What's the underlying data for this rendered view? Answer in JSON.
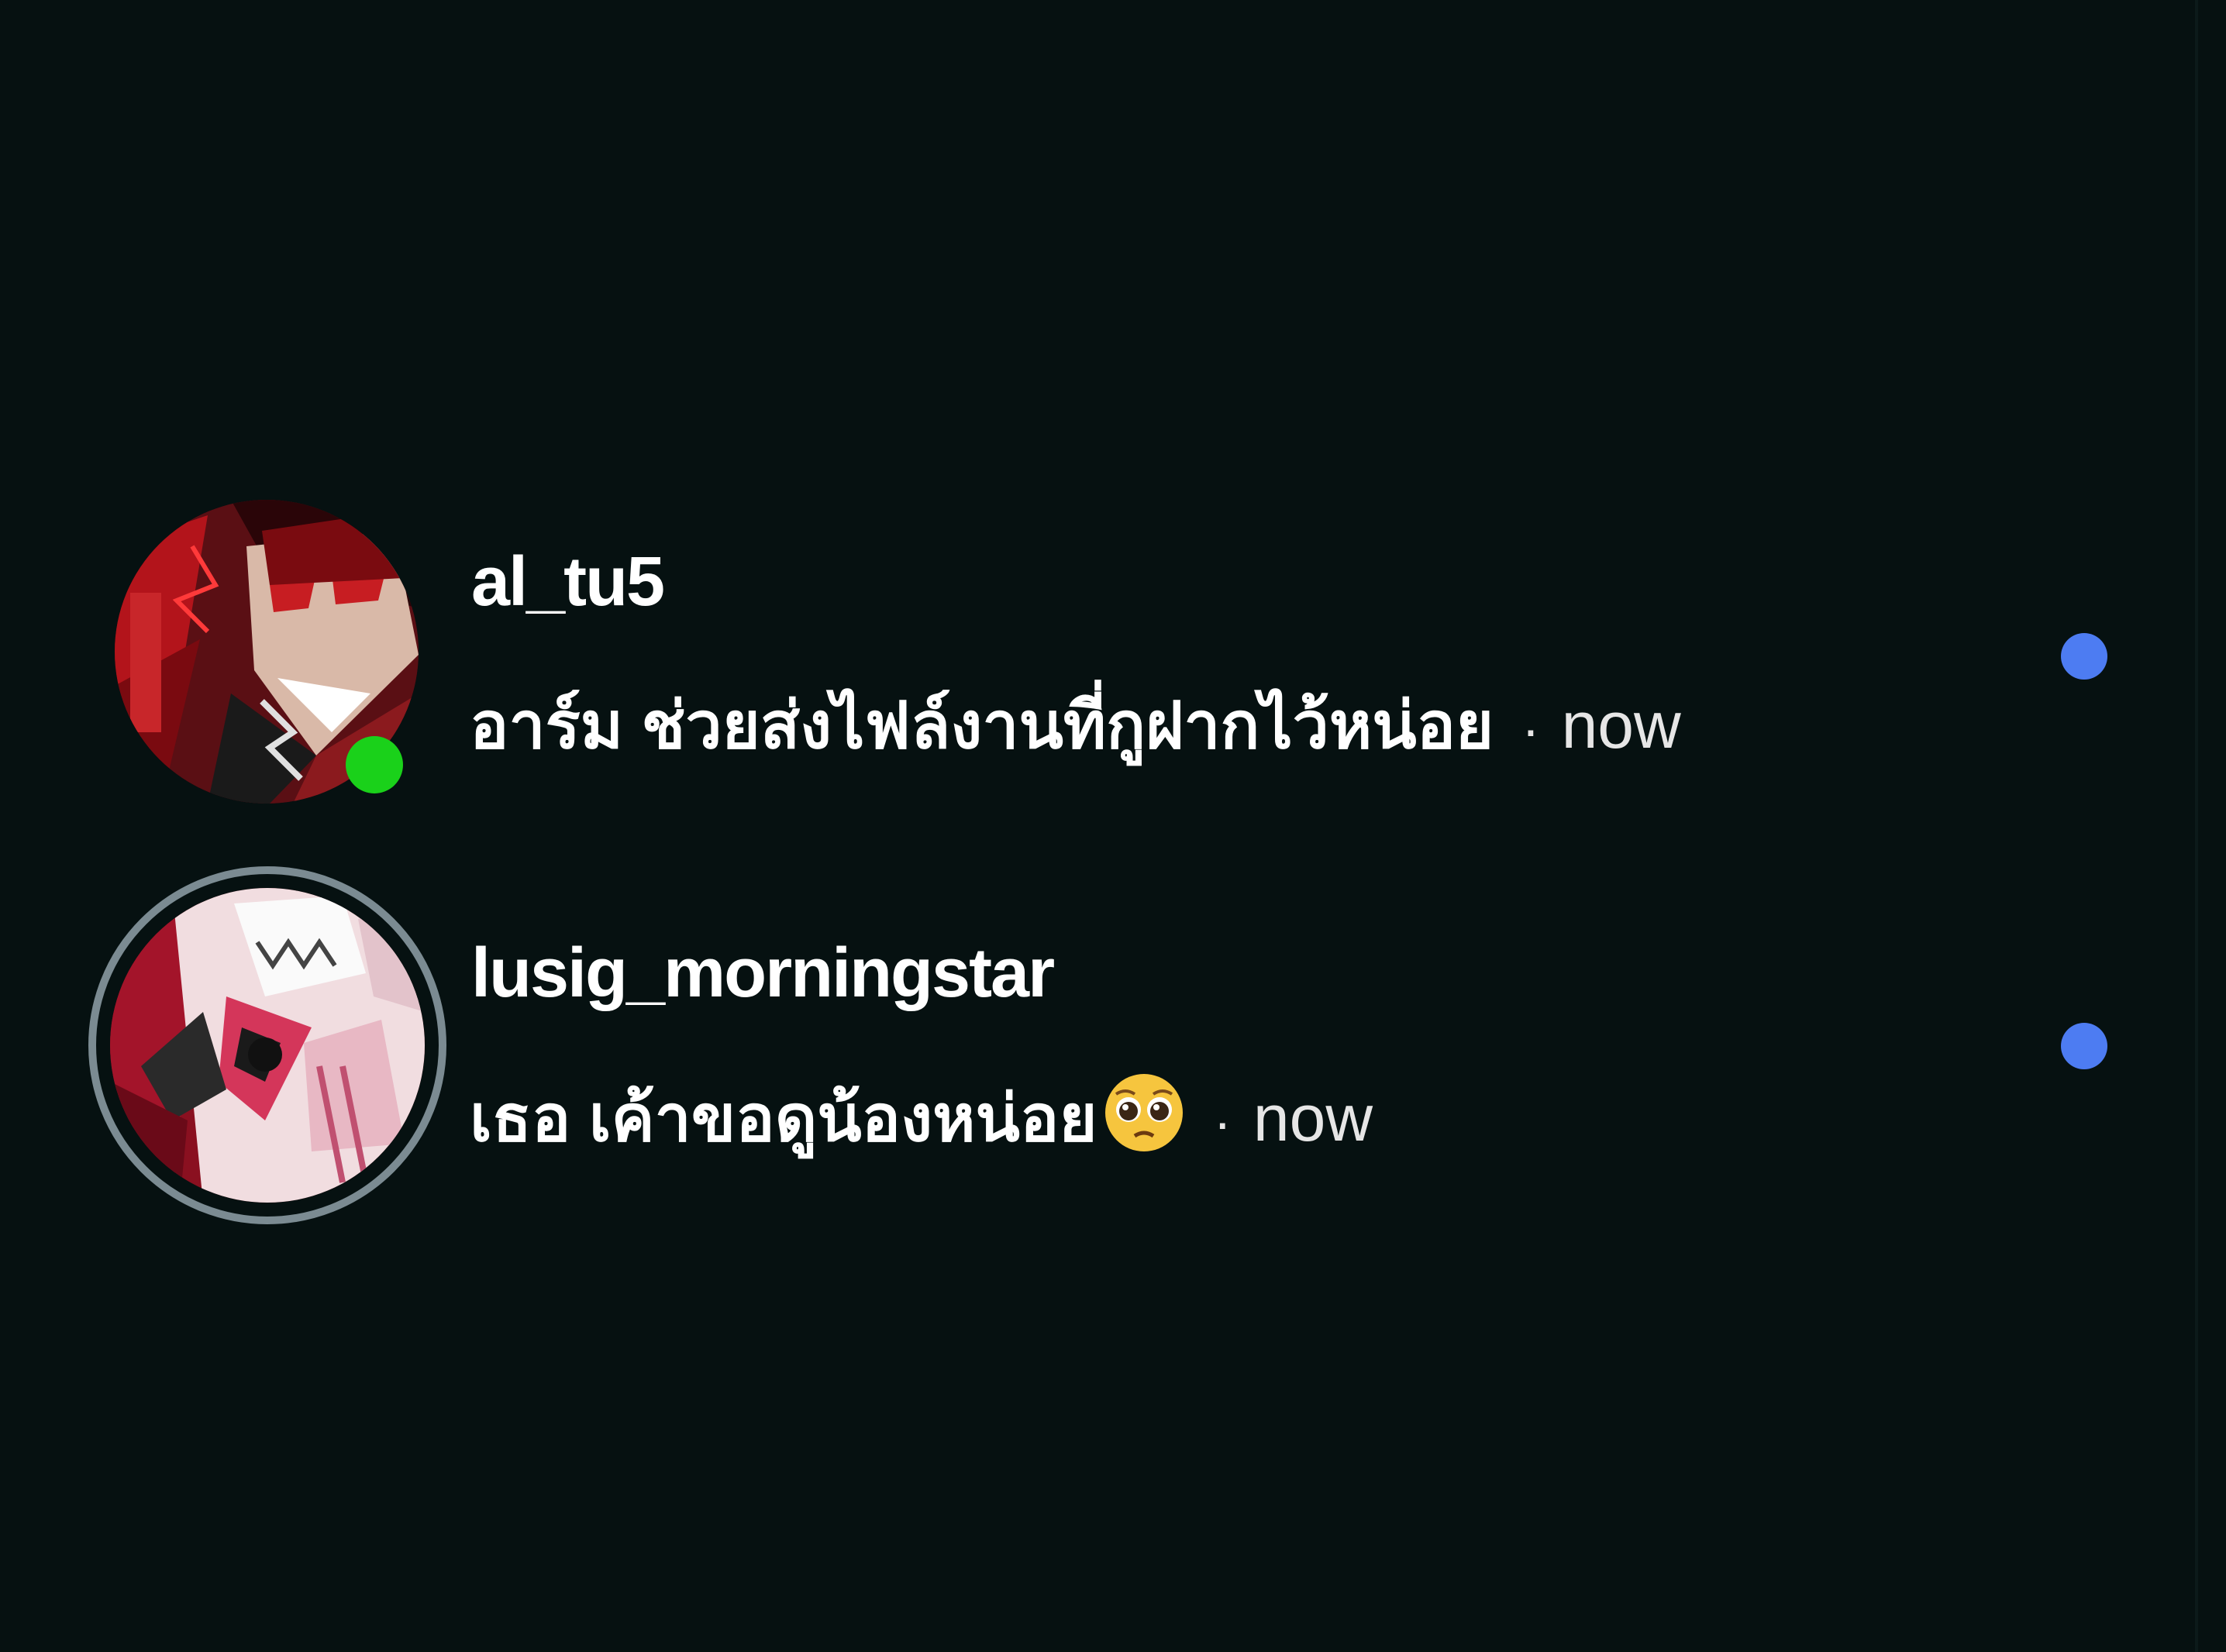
{
  "threads": [
    {
      "username": "al_tu5",
      "message": "อาร์ม ช่วยส่งไฟล์งานที่กูฝากไว้หน่อย",
      "separator": "·",
      "time": "now",
      "online": true,
      "unread": true
    },
    {
      "username": "lusig_morningstar",
      "message": "เธอ เค้าขอดูน้องหน่อย",
      "emoji": "pleading-face",
      "separator": "·",
      "time": "now",
      "online": false,
      "has_story_ring": true,
      "unread": true
    }
  ],
  "colors": {
    "background": "#061111",
    "online": "#1ad11a",
    "unread": "#4d7cf2",
    "story_ring": "#7b8b92"
  }
}
